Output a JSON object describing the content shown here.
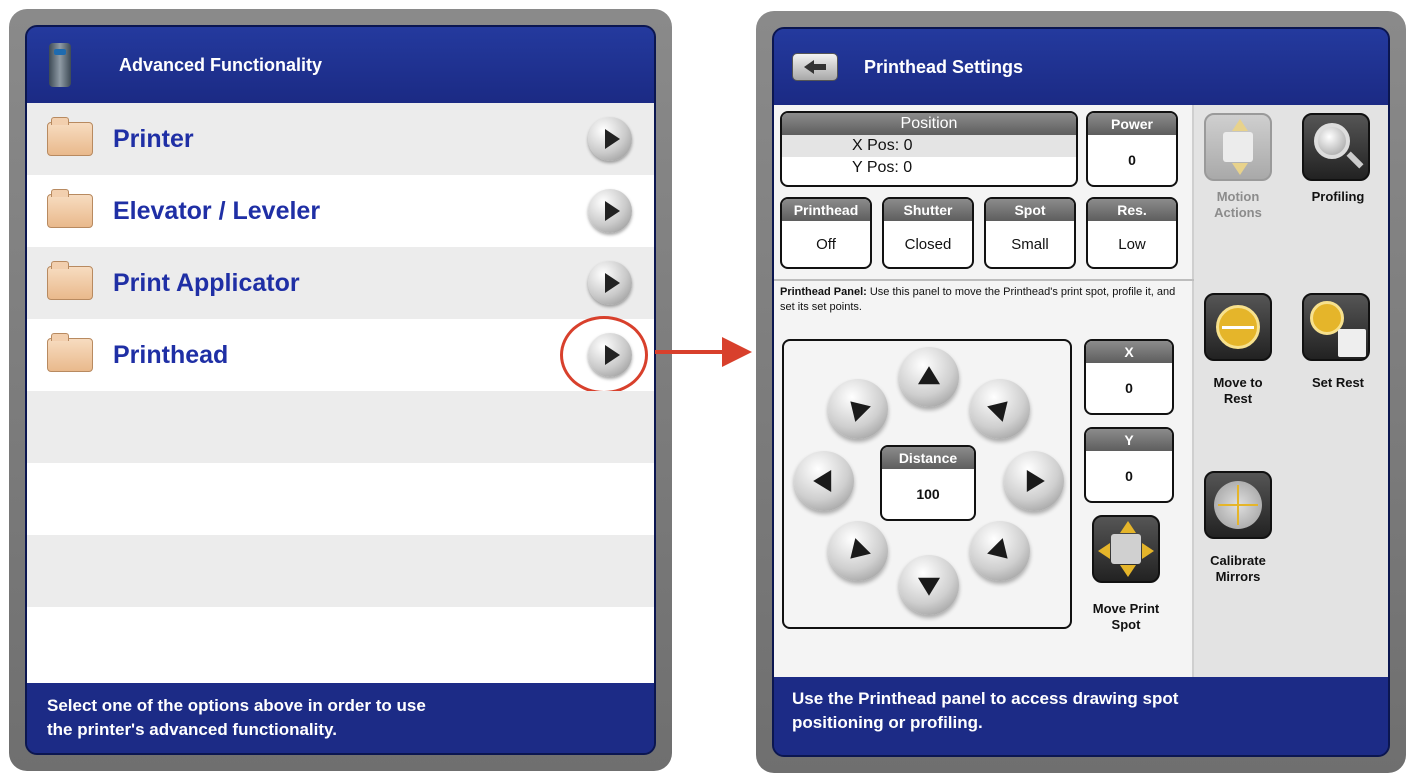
{
  "left": {
    "title": "Advanced Functionality",
    "items": [
      {
        "label": "Printer"
      },
      {
        "label": "Elevator / Leveler"
      },
      {
        "label": "Print Applicator"
      },
      {
        "label": "Printhead"
      }
    ],
    "footer_line1": "Select one of the options above in order to use",
    "footer_line2": "the printer's advanced functionality."
  },
  "right": {
    "title": "Printhead Settings",
    "position": {
      "header": "Position",
      "x_label": "X Pos:",
      "x_value": "0",
      "y_label": "Y Pos:",
      "y_value": "0"
    },
    "power": {
      "header": "Power",
      "value": "0"
    },
    "toggles": [
      {
        "header": "Printhead",
        "value": "Off"
      },
      {
        "header": "Shutter",
        "value": "Closed"
      },
      {
        "header": "Spot",
        "value": "Small"
      },
      {
        "header": "Res.",
        "value": "Low"
      }
    ],
    "panel_desc_bold": "Printhead Panel:",
    "panel_desc": " Use this panel to move the Printhead's print spot, profile it, and set its set points.",
    "distance": {
      "header": "Distance",
      "value": "100"
    },
    "x_box": {
      "header": "X",
      "value": "0"
    },
    "y_box": {
      "header": "Y",
      "value": "0"
    },
    "move_print_spot": "Move Print Spot",
    "side_buttons": {
      "motion_actions": "Motion Actions",
      "profiling": "Profiling",
      "move_to_rest": "Move to Rest",
      "set_rest": "Set Rest",
      "calibrate_mirrors": "Calibrate Mirrors"
    },
    "footer_line1": "Use the Printhead panel to access drawing spot",
    "footer_line2": "positioning or profiling."
  },
  "colors": {
    "header_blue": "#1f2f8c",
    "item_text": "#1f2fa5",
    "highlight_red": "#d8402c",
    "gold": "#e5b52a"
  }
}
